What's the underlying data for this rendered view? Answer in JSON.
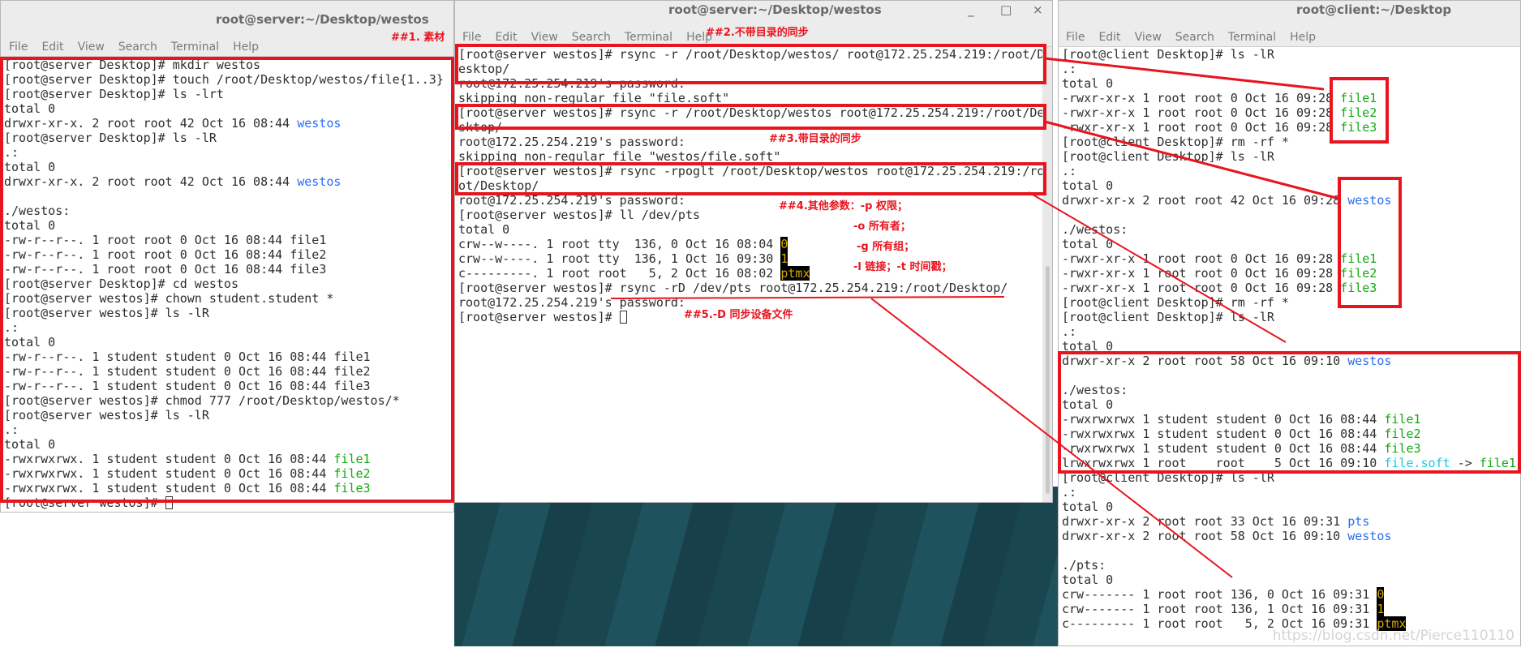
{
  "colors": {
    "annotation": "#e8141e",
    "directory": "#2a6df4",
    "executable": "#12a812",
    "symlink": "#19c9e6",
    "device": "#d4a800",
    "desktop": "#1a4650"
  },
  "menu": [
    "File",
    "Edit",
    "View",
    "Search",
    "Terminal",
    "Help"
  ],
  "windows": {
    "left": {
      "title": "root@server:~/Desktop/westos",
      "lines": [
        [
          {
            "t": "[root@server Desktop]# mkdir westos"
          }
        ],
        [
          {
            "t": "[root@server Desktop]# touch /root/Desktop/westos/file{1..3}"
          }
        ],
        [
          {
            "t": "[root@server Desktop]# ls -lrt"
          }
        ],
        [
          {
            "t": "total 0"
          }
        ],
        [
          {
            "t": "drwxr-xr-x. 2 root root 42 Oct 16 08:44 "
          },
          {
            "t": "westos",
            "c": "dir"
          }
        ],
        [
          {
            "t": "[root@server Desktop]# ls -lR"
          }
        ],
        [
          {
            "t": ".:"
          }
        ],
        [
          {
            "t": "total 0"
          }
        ],
        [
          {
            "t": "drwxr-xr-x. 2 root root 42 Oct 16 08:44 "
          },
          {
            "t": "westos",
            "c": "dir"
          }
        ],
        [
          {
            "t": ""
          }
        ],
        [
          {
            "t": "./westos:"
          }
        ],
        [
          {
            "t": "total 0"
          }
        ],
        [
          {
            "t": "-rw-r--r--. 1 root root 0 Oct 16 08:44 file1"
          }
        ],
        [
          {
            "t": "-rw-r--r--. 1 root root 0 Oct 16 08:44 file2"
          }
        ],
        [
          {
            "t": "-rw-r--r--. 1 root root 0 Oct 16 08:44 file3"
          }
        ],
        [
          {
            "t": "[root@server Desktop]# cd westos"
          }
        ],
        [
          {
            "t": "[root@server westos]# chown student.student *"
          }
        ],
        [
          {
            "t": "[root@server westos]# ls -lR"
          }
        ],
        [
          {
            "t": ".:"
          }
        ],
        [
          {
            "t": "total 0"
          }
        ],
        [
          {
            "t": "-rw-r--r--. 1 student student 0 Oct 16 08:44 file1"
          }
        ],
        [
          {
            "t": "-rw-r--r--. 1 student student 0 Oct 16 08:44 file2"
          }
        ],
        [
          {
            "t": "-rw-r--r--. 1 student student 0 Oct 16 08:44 file3"
          }
        ],
        [
          {
            "t": "[root@server westos]# chmod 777 /root/Desktop/westos/*"
          }
        ],
        [
          {
            "t": "[root@server westos]# ls -lR"
          }
        ],
        [
          {
            "t": ".:"
          }
        ],
        [
          {
            "t": "total 0"
          }
        ],
        [
          {
            "t": "-rwxrwxrwx. 1 student student 0 Oct 16 08:44 "
          },
          {
            "t": "file1",
            "c": "exe"
          }
        ],
        [
          {
            "t": "-rwxrwxrwx. 1 student student 0 Oct 16 08:44 "
          },
          {
            "t": "file2",
            "c": "exe"
          }
        ],
        [
          {
            "t": "-rwxrwxrwx. 1 student student 0 Oct 16 08:44 "
          },
          {
            "t": "file3",
            "c": "exe"
          }
        ],
        [
          {
            "t": "[root@server westos]# "
          },
          {
            "t": "",
            "c": "cursor"
          }
        ]
      ]
    },
    "middle": {
      "title": "root@server:~/Desktop/westos",
      "controls": {
        "minimize": "_",
        "maximize": "□",
        "close": "×"
      },
      "lines": [
        [
          {
            "t": "[root@server westos]# rsync -r /root/Desktop/westos/ root@172.25.254.219:/root/D"
          }
        ],
        [
          {
            "t": "esktop/"
          }
        ],
        [
          {
            "t": "root@172.25.254.219's password:"
          }
        ],
        [
          {
            "t": "skipping non-regular file \"file.soft\""
          }
        ],
        [
          {
            "t": "[root@server westos]# rsync -r /root/Desktop/westos root@172.25.254.219:/root/De"
          }
        ],
        [
          {
            "t": "sktop/"
          }
        ],
        [
          {
            "t": "root@172.25.254.219's password:"
          }
        ],
        [
          {
            "t": "skipping non-regular file \"westos/file.soft\""
          }
        ],
        [
          {
            "t": "[root@server westos]# rsync -rpoglt /root/Desktop/westos root@172.25.254.219:/ro"
          }
        ],
        [
          {
            "t": "ot/Desktop/"
          }
        ],
        [
          {
            "t": "root@172.25.254.219's password:"
          }
        ],
        [
          {
            "t": "[root@server westos]# ll /dev/pts"
          }
        ],
        [
          {
            "t": "total 0"
          }
        ],
        [
          {
            "t": "crw--w----. 1 root tty  136, 0 Oct 16 08:04 "
          },
          {
            "t": "0",
            "c": "dev"
          }
        ],
        [
          {
            "t": "crw--w----. 1 root tty  136, 1 Oct 16 09:30 "
          },
          {
            "t": "1",
            "c": "dev"
          }
        ],
        [
          {
            "t": "c---------. 1 root root   5, 2 Oct 16 08:02 "
          },
          {
            "t": "ptmx",
            "c": "dev"
          }
        ],
        [
          {
            "t": "[root@server westos]# rsync -rD /dev/pts root@172.25.254.219:/root/Desktop/"
          }
        ],
        [
          {
            "t": "root@172.25.254.219's password:"
          }
        ],
        [
          {
            "t": "[root@server westos]# "
          },
          {
            "t": "",
            "c": "cursor"
          }
        ]
      ]
    },
    "right": {
      "title": "root@client:~/Desktop",
      "lines": [
        [
          {
            "t": "[root@client Desktop]# ls -lR"
          }
        ],
        [
          {
            "t": ".:"
          }
        ],
        [
          {
            "t": "total 0"
          }
        ],
        [
          {
            "t": "-rwxr-xr-x 1 root root 0 Oct 16 09:28 "
          },
          {
            "t": "file1",
            "c": "exe"
          }
        ],
        [
          {
            "t": "-rwxr-xr-x 1 root root 0 Oct 16 09:28 "
          },
          {
            "t": "file2",
            "c": "exe"
          }
        ],
        [
          {
            "t": "-rwxr-xr-x 1 root root 0 Oct 16 09:28 "
          },
          {
            "t": "file3",
            "c": "exe"
          }
        ],
        [
          {
            "t": "[root@client Desktop]# rm -rf *"
          }
        ],
        [
          {
            "t": "[root@client Desktop]# ls -lR"
          }
        ],
        [
          {
            "t": ".:"
          }
        ],
        [
          {
            "t": "total 0"
          }
        ],
        [
          {
            "t": "drwxr-xr-x 2 root root 42 Oct 16 09:28 "
          },
          {
            "t": "westos",
            "c": "dir"
          }
        ],
        [
          {
            "t": ""
          }
        ],
        [
          {
            "t": "./westos:"
          }
        ],
        [
          {
            "t": "total 0"
          }
        ],
        [
          {
            "t": "-rwxr-xr-x 1 root root 0 Oct 16 09:28 "
          },
          {
            "t": "file1",
            "c": "exe"
          }
        ],
        [
          {
            "t": "-rwxr-xr-x 1 root root 0 Oct 16 09:28 "
          },
          {
            "t": "file2",
            "c": "exe"
          }
        ],
        [
          {
            "t": "-rwxr-xr-x 1 root root 0 Oct 16 09:28 "
          },
          {
            "t": "file3",
            "c": "exe"
          }
        ],
        [
          {
            "t": "[root@client Desktop]# rm -rf *"
          }
        ],
        [
          {
            "t": "[root@client Desktop]# ls -lR"
          }
        ],
        [
          {
            "t": ".:"
          }
        ],
        [
          {
            "t": "total 0"
          }
        ],
        [
          {
            "t": "drwxr-xr-x 2 root root 58 Oct 16 09:10 "
          },
          {
            "t": "westos",
            "c": "dir"
          }
        ],
        [
          {
            "t": ""
          }
        ],
        [
          {
            "t": "./westos:"
          }
        ],
        [
          {
            "t": "total 0"
          }
        ],
        [
          {
            "t": "-rwxrwxrwx 1 student student 0 Oct 16 08:44 "
          },
          {
            "t": "file1",
            "c": "exe"
          }
        ],
        [
          {
            "t": "-rwxrwxrwx 1 student student 0 Oct 16 08:44 "
          },
          {
            "t": "file2",
            "c": "exe"
          }
        ],
        [
          {
            "t": "-rwxrwxrwx 1 student student 0 Oct 16 08:44 "
          },
          {
            "t": "file3",
            "c": "exe"
          }
        ],
        [
          {
            "t": "lrwxrwxrwx 1 root    root    5 Oct 16 09:10 "
          },
          {
            "t": "file.soft",
            "c": "link"
          },
          {
            "t": " -> "
          },
          {
            "t": "file1",
            "c": "exe"
          }
        ],
        [
          {
            "t": "[root@client Desktop]# ls -lR"
          }
        ],
        [
          {
            "t": ".:"
          }
        ],
        [
          {
            "t": "total 0"
          }
        ],
        [
          {
            "t": "drwxr-xr-x 2 root root 33 Oct 16 09:31 "
          },
          {
            "t": "pts",
            "c": "dir"
          }
        ],
        [
          {
            "t": "drwxr-xr-x 2 root root 58 Oct 16 09:10 "
          },
          {
            "t": "westos",
            "c": "dir"
          }
        ],
        [
          {
            "t": ""
          }
        ],
        [
          {
            "t": "./pts:"
          }
        ],
        [
          {
            "t": "total 0"
          }
        ],
        [
          {
            "t": "crw------- 1 root root 136, 0 Oct 16 09:31 "
          },
          {
            "t": "0",
            "c": "dev"
          }
        ],
        [
          {
            "t": "crw------- 1 root root 136, 1 Oct 16 09:31 "
          },
          {
            "t": "1",
            "c": "dev"
          }
        ],
        [
          {
            "t": "c--------- 1 root root   5, 2 Oct 16 09:31 "
          },
          {
            "t": "ptmx",
            "c": "dev"
          }
        ]
      ]
    }
  },
  "annotations": {
    "a1": "##1. 素材",
    "a2": "##2.不带目录的同步",
    "a3": "##3.带目录的同步",
    "a4": "##4.其他参数：-p  权限；",
    "a4o": "-o 所有者；",
    "a4g": "-g 所有组；",
    "a4l": "-l 链接；-t 时间戳；",
    "a5": "##5.-D  同步设备文件"
  },
  "watermark": "https://blog.csdn.net/Pierce110110"
}
